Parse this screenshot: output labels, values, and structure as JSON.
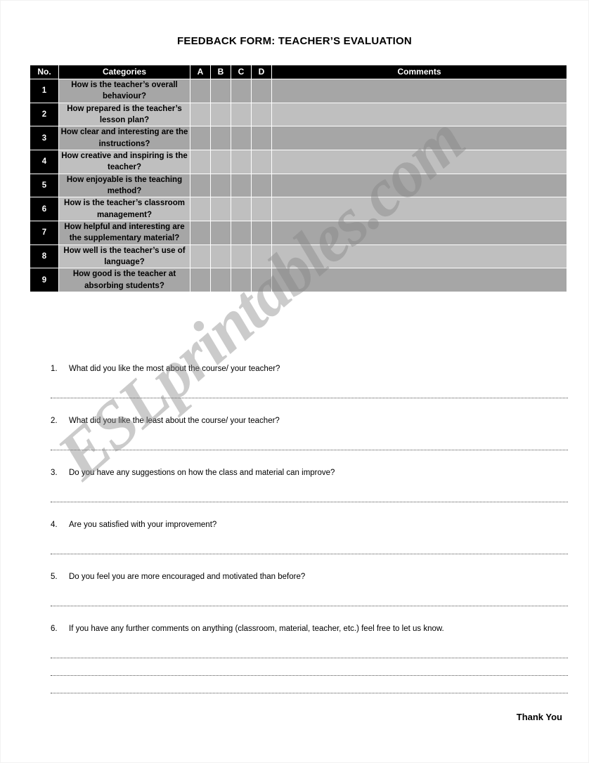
{
  "document": {
    "title": "FEEDBACK FORM: TEACHER’S EVALUATION",
    "footer_note": "Thank You",
    "watermark": "ESLprintables.com"
  },
  "table": {
    "headers": {
      "no": "No.",
      "categories": "Categories",
      "a": "A",
      "b": "B",
      "c": "C",
      "d": "D",
      "comments": "Comments"
    },
    "rows": [
      {
        "no": "1",
        "category": "How is the teacher’s overall behaviour?",
        "a": "",
        "b": "",
        "c": "",
        "d": "",
        "comment": ""
      },
      {
        "no": "2",
        "category": "How prepared is the teacher’s lesson plan?",
        "a": "",
        "b": "",
        "c": "",
        "d": "",
        "comment": ""
      },
      {
        "no": "3",
        "category": "How clear and interesting are the instructions?",
        "a": "",
        "b": "",
        "c": "",
        "d": "",
        "comment": ""
      },
      {
        "no": "4",
        "category": "How creative and inspiring is the teacher?",
        "a": "",
        "b": "",
        "c": "",
        "d": "",
        "comment": ""
      },
      {
        "no": "5",
        "category": "How enjoyable is the teaching method?",
        "a": "",
        "b": "",
        "c": "",
        "d": "",
        "comment": ""
      },
      {
        "no": "6",
        "category": "How is the teacher’s classroom management?",
        "a": "",
        "b": "",
        "c": "",
        "d": "",
        "comment": ""
      },
      {
        "no": "7",
        "category": "How helpful and interesting are the supplementary material?",
        "a": "",
        "b": "",
        "c": "",
        "d": "",
        "comment": ""
      },
      {
        "no": "8",
        "category": "How well is the teacher’s use of language?",
        "a": "",
        "b": "",
        "c": "",
        "d": "",
        "comment": ""
      },
      {
        "no": "9",
        "category": "How good is the teacher at absorbing students?",
        "a": "",
        "b": "",
        "c": "",
        "d": "",
        "comment": ""
      }
    ]
  },
  "questions": [
    {
      "num": "1.",
      "text": "What did you like the most about the course/ your teacher?"
    },
    {
      "num": "2.",
      "text": "What did you like the least about the course/ your teacher?"
    },
    {
      "num": "3.",
      "text": "Do you have any suggestions on how the class and material can improve?"
    },
    {
      "num": "4.",
      "text": "Are you satisfied with your improvement?"
    },
    {
      "num": "5.",
      "text": "Do you feel you are more encouraged and motivated than before?"
    },
    {
      "num": "6.",
      "text": "If you have any further comments on anything (classroom, material, teacher, etc.) feel free to let us know."
    }
  ],
  "colors": {
    "header_background": "#000000",
    "header_text": "#ffffff",
    "row_dark": "#a6a6a6",
    "row_light": "#bfbfbf",
    "page_background": "#ffffff",
    "text": "#000000"
  }
}
